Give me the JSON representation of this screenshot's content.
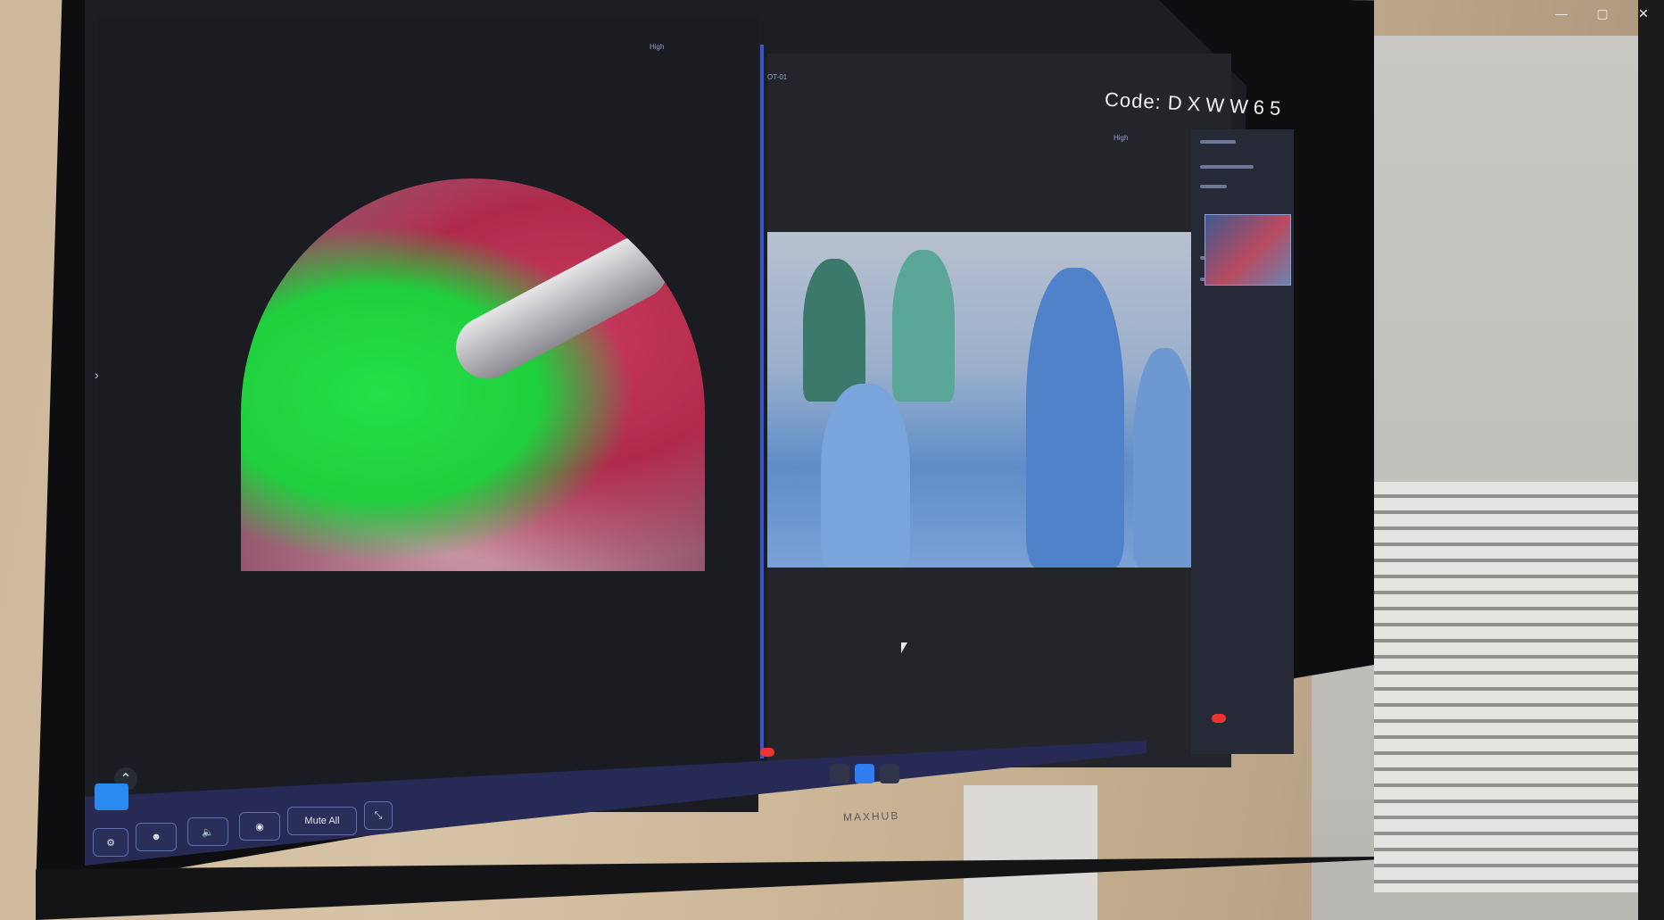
{
  "window_controls": {
    "minimize": "—",
    "restore": "▢",
    "close": "✕"
  },
  "screen": {
    "code_label": "Code:",
    "code_value": "DXWW65",
    "header_quality_left": "High",
    "header_quality_right": "High",
    "header_source": "OT-01"
  },
  "toolbar": {
    "mute_all_label": "Mute All",
    "up_glyph": "⌃",
    "left_arrow_glyph": "›"
  },
  "monitor": {
    "brand": "MAXHUB"
  },
  "colors": {
    "accent_blue": "#2f7df0",
    "fluorescence_green": "#25e04a",
    "record_red": "#e33333"
  }
}
